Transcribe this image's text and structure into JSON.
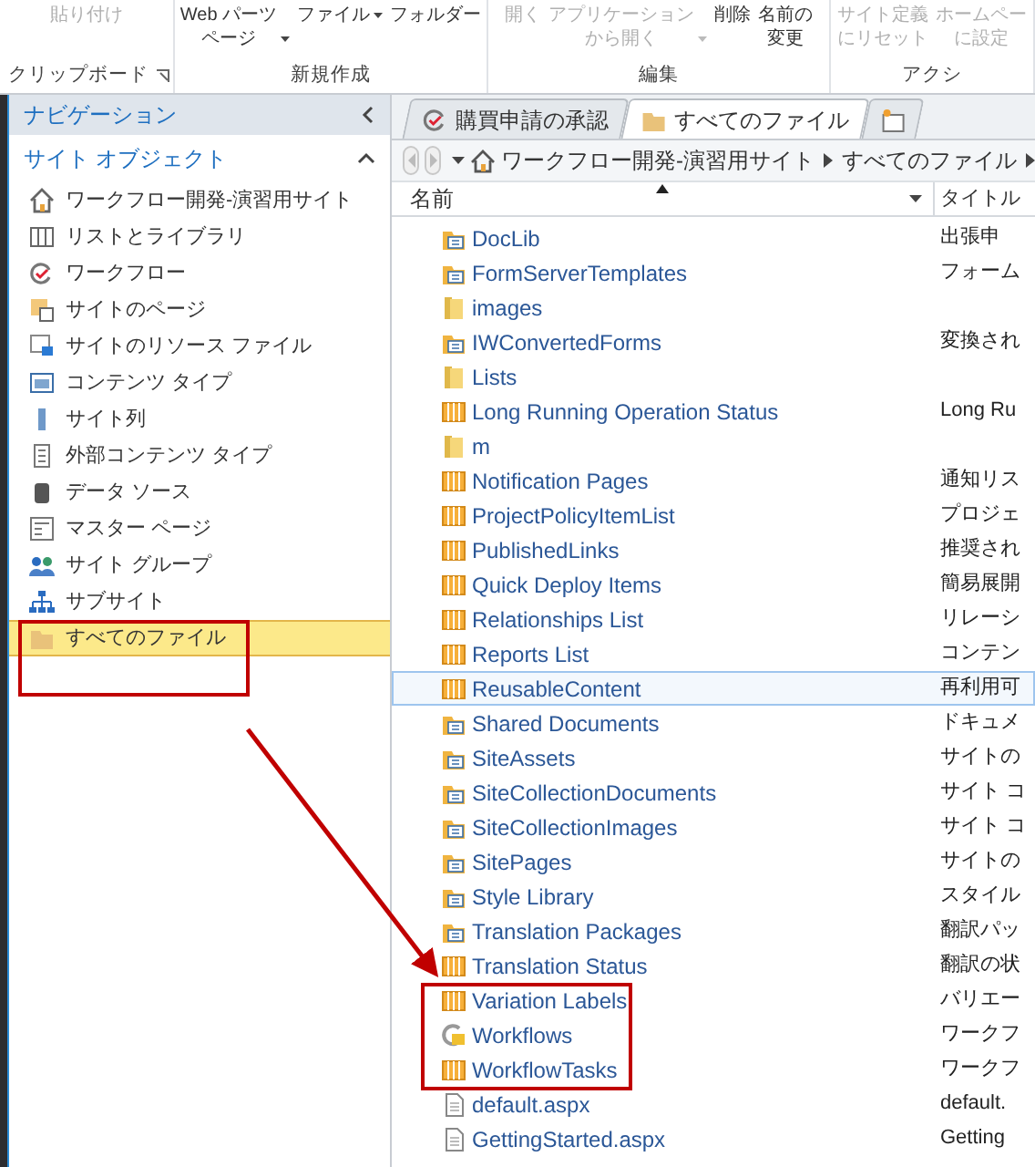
{
  "ribbon": {
    "groups": [
      {
        "label": "クリップボード",
        "launcher": true,
        "buttons": [
          {
            "lines": [
              "貼り付け"
            ],
            "disabled": true
          }
        ]
      },
      {
        "label": "新規作成",
        "buttons": [
          {
            "lines": [
              "Web パーツ",
              "ページ"
            ],
            "dropdown": true,
            "disabled": false
          },
          {
            "lines": [
              "ファイル"
            ],
            "dropdown": true,
            "disabled": false
          },
          {
            "lines": [
              "フォルダー"
            ],
            "disabled": false
          }
        ]
      },
      {
        "label": "編集",
        "buttons": [
          {
            "lines": [
              "開く"
            ],
            "disabled": true
          },
          {
            "lines": [
              "アプリケーション",
              "から開く"
            ],
            "dropdown": true,
            "disabled": true
          },
          {
            "lines": [
              "削除"
            ],
            "disabled": false
          },
          {
            "lines": [
              "名前の",
              "変更"
            ],
            "disabled": false
          }
        ]
      },
      {
        "label": "アクシ",
        "buttons": [
          {
            "lines": [
              "サイト定義",
              "にリセット"
            ],
            "disabled": true
          },
          {
            "lines": [
              "ホームペー",
              "に設定"
            ],
            "disabled": true
          }
        ]
      }
    ]
  },
  "navigation": {
    "title": "ナビゲーション",
    "section": "サイト オブジェクト",
    "items": [
      {
        "kind": "home",
        "label": "ワークフロー開発-演習用サイト",
        "selected": false
      },
      {
        "kind": "lists",
        "label": "リストとライブラリ",
        "selected": false
      },
      {
        "kind": "workflow",
        "label": "ワークフロー",
        "selected": false
      },
      {
        "kind": "pages",
        "label": "サイトのページ",
        "selected": false
      },
      {
        "kind": "assets",
        "label": "サイトのリソース ファイル",
        "selected": false
      },
      {
        "kind": "ctype",
        "label": "コンテンツ タイプ",
        "selected": false
      },
      {
        "kind": "column",
        "label": "サイト列",
        "selected": false
      },
      {
        "kind": "external",
        "label": "外部コンテンツ タイプ",
        "selected": false
      },
      {
        "kind": "data",
        "label": "データ ソース",
        "selected": false
      },
      {
        "kind": "master",
        "label": "マスター ページ",
        "selected": false
      },
      {
        "kind": "groups",
        "label": "サイト グループ",
        "selected": false
      },
      {
        "kind": "subsite",
        "label": "サブサイト",
        "selected": false
      },
      {
        "kind": "files",
        "label": "すべてのファイル",
        "selected": true
      }
    ]
  },
  "tabs": [
    {
      "kind": "workflow",
      "label": "購買申請の承認",
      "selected": false
    },
    {
      "kind": "folder",
      "label": "すべてのファイル",
      "selected": true
    }
  ],
  "breadcrumb": [
    "ワークフロー開発-演習用サイト",
    "すべてのファイル"
  ],
  "table": {
    "columns": [
      "名前",
      "タイトル"
    ],
    "rows": [
      {
        "kind": "doclib",
        "name": "DocLib",
        "title": "出張申",
        "selected": false
      },
      {
        "kind": "doclib",
        "name": "FormServerTemplates",
        "title": "フォーム",
        "selected": false
      },
      {
        "kind": "folder",
        "name": "images",
        "selected": false
      },
      {
        "kind": "doclib",
        "name": "IWConvertedForms",
        "title": "変換され",
        "selected": false
      },
      {
        "kind": "folder",
        "name": "Lists",
        "selected": false
      },
      {
        "kind": "list",
        "name": "Long Running Operation Status",
        "title": "Long Ru",
        "selected": false
      },
      {
        "kind": "folder",
        "name": "m",
        "selected": false
      },
      {
        "kind": "list",
        "name": "Notification Pages",
        "title": "通知リス",
        "selected": false
      },
      {
        "kind": "list",
        "name": "ProjectPolicyItemList",
        "title": "プロジェ",
        "selected": false
      },
      {
        "kind": "list",
        "name": "PublishedLinks",
        "title": "推奨され",
        "selected": false
      },
      {
        "kind": "list",
        "name": "Quick Deploy Items",
        "title": "簡易展開",
        "selected": false
      },
      {
        "kind": "list",
        "name": "Relationships List",
        "title": "リレーシ",
        "selected": false
      },
      {
        "kind": "list",
        "name": "Reports List",
        "title": "コンテン",
        "selected": false
      },
      {
        "kind": "list",
        "name": "ReusableContent",
        "title": "再利用可",
        "selected": true
      },
      {
        "kind": "doclib",
        "name": "Shared Documents",
        "title": "ドキュメ",
        "selected": false
      },
      {
        "kind": "doclib",
        "name": "SiteAssets",
        "title": "サイトの",
        "selected": false
      },
      {
        "kind": "doclib",
        "name": "SiteCollectionDocuments",
        "title": "サイト コ",
        "selected": false
      },
      {
        "kind": "doclib",
        "name": "SiteCollectionImages",
        "title": "サイト コ",
        "selected": false
      },
      {
        "kind": "doclib",
        "name": "SitePages",
        "title": "サイトの",
        "selected": false
      },
      {
        "kind": "doclib",
        "name": "Style Library",
        "title": "スタイル",
        "selected": false
      },
      {
        "kind": "doclib",
        "name": "Translation Packages",
        "title": "翻訳パッ",
        "selected": false
      },
      {
        "kind": "list",
        "name": "Translation Status",
        "title": "翻訳の状",
        "selected": false
      },
      {
        "kind": "list",
        "name": "Variation Labels",
        "title": "バリエー",
        "selected": false
      },
      {
        "kind": "workflow",
        "name": "Workflows",
        "title": "ワークフ",
        "selected": false
      },
      {
        "kind": "list",
        "name": "WorkflowTasks",
        "title": "ワークフ",
        "selected": false
      },
      {
        "kind": "page",
        "name": "default.aspx",
        "title": "default.",
        "selected": false
      },
      {
        "kind": "page",
        "name": "GettingStarted.aspx",
        "title": "Getting",
        "selected": false
      }
    ]
  }
}
